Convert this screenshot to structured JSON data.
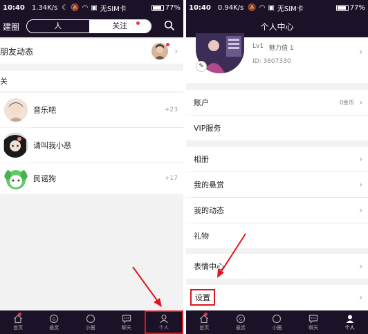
{
  "left": {
    "status": {
      "time": "10:40",
      "speed": "1.34K/s",
      "sim": "无SIM卡",
      "battery": "77%"
    },
    "header": {
      "left_label": "建圈",
      "tabs": [
        "人",
        "关注"
      ]
    },
    "friends_row": {
      "label": "朋友动态"
    },
    "section_label": "关",
    "circles": [
      {
        "name": "音乐吧",
        "count": "+23"
      },
      {
        "name": "请叫我小恶",
        "count": ""
      },
      {
        "name": "民谣狗",
        "count": "+17"
      }
    ]
  },
  "right": {
    "status": {
      "time": "10:40",
      "speed": "0.94K/s",
      "sim": "无SIM卡",
      "battery": "77%"
    },
    "title": "个人中心",
    "profile": {
      "level": "Lv1",
      "charm": "魅力值 1",
      "id": "ID: 3607330"
    },
    "menu": {
      "account": "账户",
      "account_value": "0金币",
      "vip": "VIP服务",
      "album": "相册",
      "reward": "我的悬赏",
      "feed": "我的动态",
      "gift": "礼物",
      "emoji": "表情中心",
      "settings": "设置"
    }
  },
  "tabbar": [
    "首页",
    "悬赏",
    "小圈",
    "聊天",
    "个人"
  ],
  "colors": {
    "bar": "#1c1228",
    "accent": "#e8334b",
    "annotation": "#e0141e"
  }
}
